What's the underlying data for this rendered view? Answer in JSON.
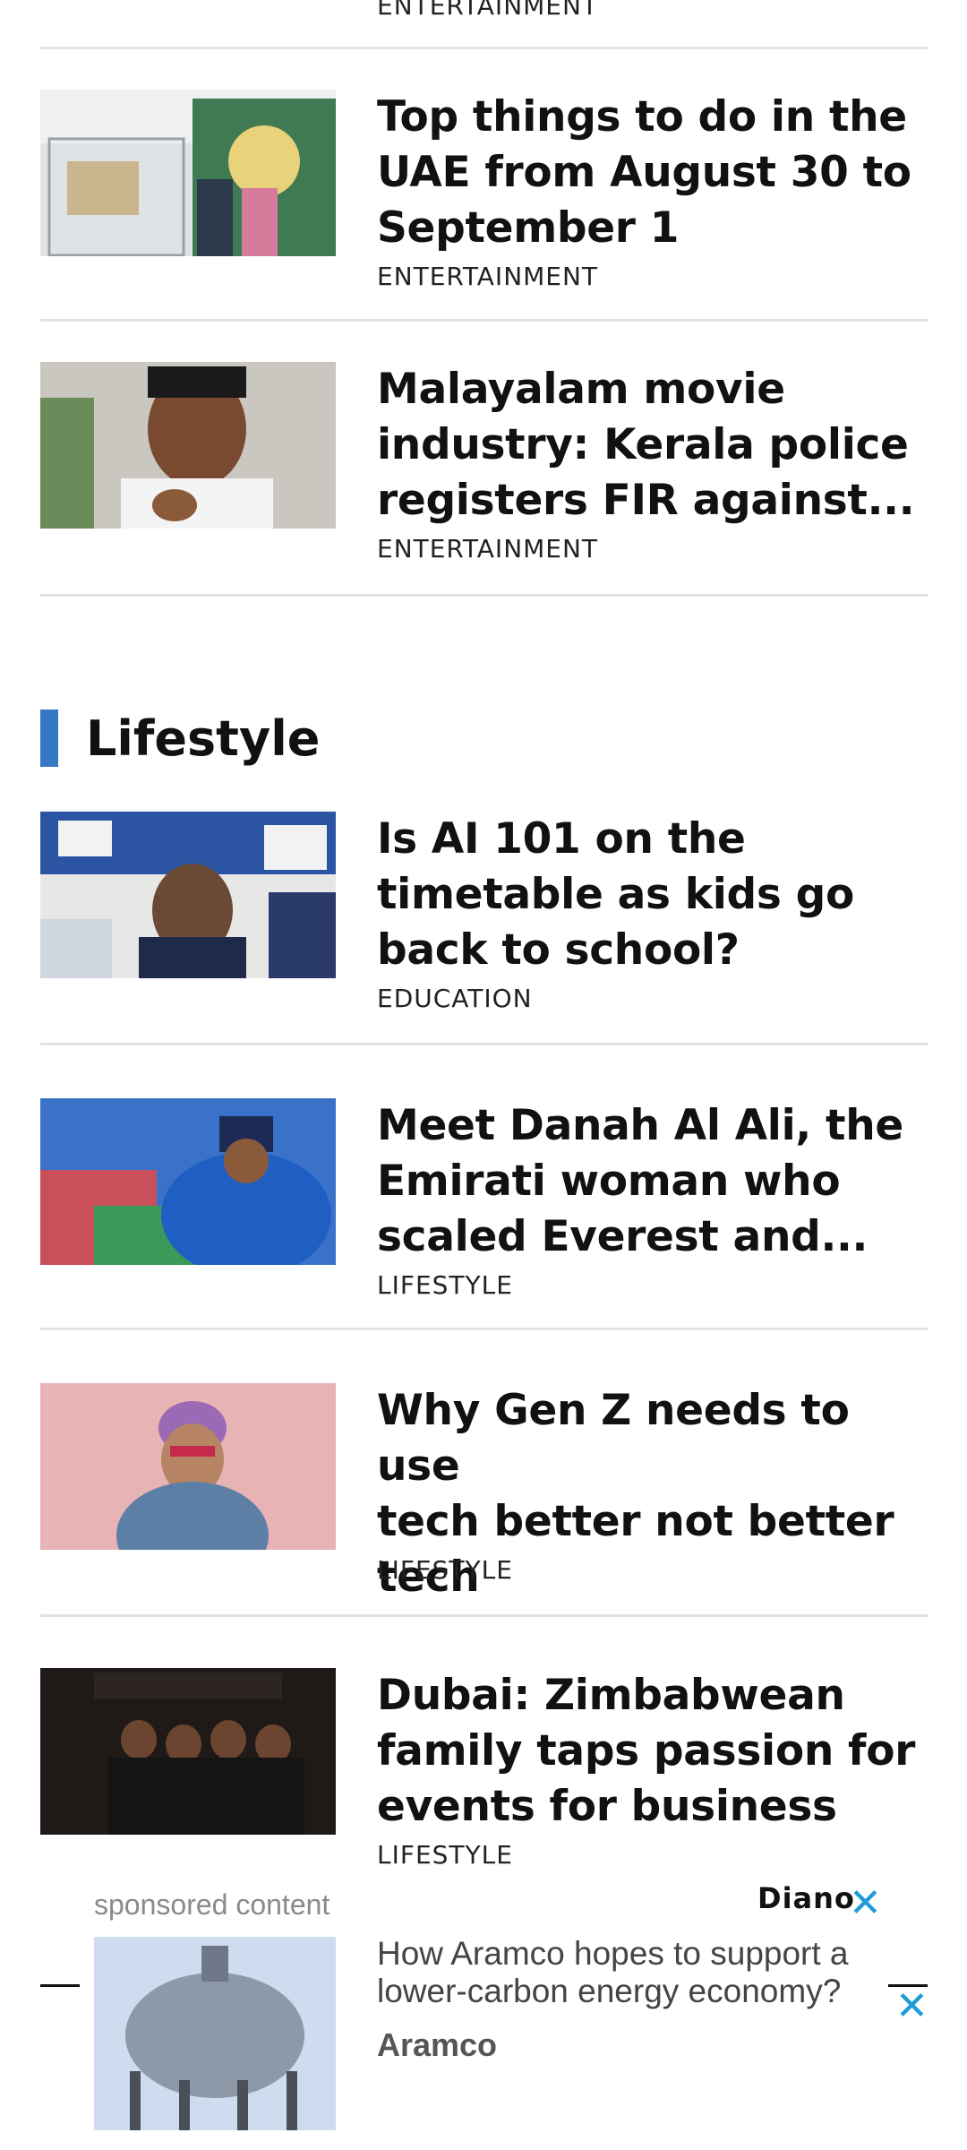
{
  "top_partial_category": "ENTERTAINMENT",
  "articles_top": [
    {
      "headline_lines": [
        "Top things to do in the",
        "UAE from August 30 to",
        "September 1"
      ],
      "category": "ENTERTAINMENT"
    },
    {
      "headline_lines": [
        "Malayalam movie",
        "industry: Kerala police",
        "registers FIR against..."
      ],
      "category": "ENTERTAINMENT"
    }
  ],
  "section": {
    "title": "Lifestyle",
    "accent_color": "#3478c6"
  },
  "articles_lifestyle": [
    {
      "headline_lines": [
        "Is AI 101 on the",
        "timetable as kids go",
        "back to school?"
      ],
      "category": "EDUCATION"
    },
    {
      "headline_lines": [
        "Meet Danah Al Ali, the",
        "Emirati woman who",
        "scaled Everest and..."
      ],
      "category": "LIFESTYLE"
    },
    {
      "headline_lines": [
        "Why Gen Z needs to use",
        "tech better not better",
        "tech"
      ],
      "category": "LIFESTYLE"
    },
    {
      "headline_lines": [
        "Dubai: Zimbabwean",
        "family taps passion for",
        "events for business"
      ],
      "category": "LIFESTYLE"
    }
  ],
  "ad": {
    "label": "sponsored content",
    "brand_logo": "Diano",
    "close_icon": "close-icon",
    "text_lines": [
      "How Aramco hopes to support a",
      "lower-carbon energy economy?"
    ],
    "sponsor": "Aramco",
    "close_color": "#1e9bd7"
  }
}
